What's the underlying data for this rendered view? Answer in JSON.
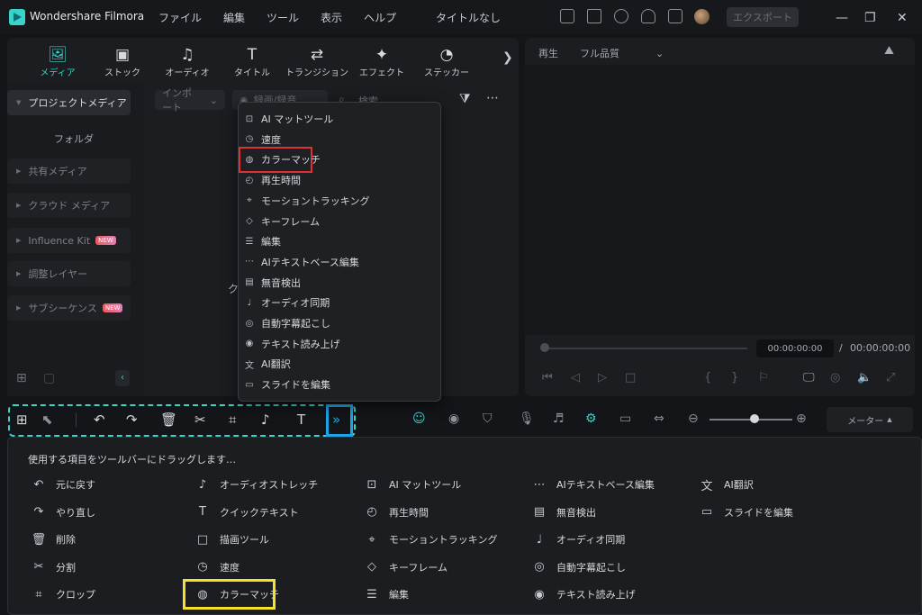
{
  "app": {
    "title": "Wondershare Filmora",
    "doc_title": "タイトルなし",
    "export_label": "エクスポート"
  },
  "menu": [
    "ファイル",
    "編集",
    "ツール",
    "表示",
    "ヘルプ"
  ],
  "media_tabs": [
    {
      "label": "メディア",
      "icon": "media-icon",
      "glyph": "🖼"
    },
    {
      "label": "ストック",
      "icon": "stock-icon",
      "glyph": "▣"
    },
    {
      "label": "オーディオ",
      "icon": "audio-icon",
      "glyph": "♫"
    },
    {
      "label": "タイトル",
      "icon": "title-icon",
      "glyph": "T"
    },
    {
      "label": "トランジション",
      "icon": "transition-icon",
      "glyph": "⇄"
    },
    {
      "label": "エフェクト",
      "icon": "effect-icon",
      "glyph": "✦"
    },
    {
      "label": "ステッカー",
      "icon": "sticker-icon",
      "glyph": "◔"
    }
  ],
  "sidebar": {
    "items": [
      {
        "label": "プロジェクトメディア",
        "active": true,
        "new": false
      },
      {
        "label": "共有メディア",
        "active": false,
        "new": false
      },
      {
        "label": "クラウド メディア",
        "active": false,
        "new": false
      },
      {
        "label": "Influence Kit",
        "active": false,
        "new": true
      },
      {
        "label": "調整レイヤー",
        "active": false,
        "new": false
      },
      {
        "label": "サブシーケンス",
        "active": false,
        "new": true
      }
    ],
    "sub": "フォルダ",
    "new_badge": "NEW"
  },
  "media_toolbar": {
    "import": "インポート",
    "record": "録画/録音",
    "search": "検索",
    "partial": "ク"
  },
  "preview": {
    "play_label": "再生",
    "quality": "フル品質",
    "time_current": "00:00:00:00",
    "time_sep": "/",
    "time_total": "00:00:00:00"
  },
  "dropdown": [
    {
      "label": "AI マットツール",
      "glyph": "⊡"
    },
    {
      "label": "速度",
      "glyph": "◷"
    },
    {
      "label": "カラーマッチ",
      "glyph": "◍"
    },
    {
      "label": "再生時間",
      "glyph": "◴"
    },
    {
      "label": "モーショントラッキング",
      "glyph": "⌖"
    },
    {
      "label": "キーフレーム",
      "glyph": "◇"
    },
    {
      "label": "編集",
      "glyph": "☰"
    },
    {
      "label": "AIテキストベース編集",
      "glyph": "⋯"
    },
    {
      "label": "無音検出",
      "glyph": "▤"
    },
    {
      "label": "オーディオ同期",
      "glyph": "♩"
    },
    {
      "label": "自動字幕起こし",
      "glyph": "◎"
    },
    {
      "label": "テキスト読み上げ",
      "glyph": "◉"
    },
    {
      "label": "AI翻訳",
      "glyph": "文"
    },
    {
      "label": "スライドを編集",
      "glyph": "▭"
    }
  ],
  "meter_label": "メーター",
  "drag_panel": {
    "title": "使用する項目をツールバーにドラッグします…",
    "columns": [
      [
        {
          "label": "元に戻す",
          "glyph": "↶"
        },
        {
          "label": "やり直し",
          "glyph": "↷"
        },
        {
          "label": "削除",
          "glyph": "🗑"
        },
        {
          "label": "分割",
          "glyph": "✂"
        },
        {
          "label": "クロップ",
          "glyph": "⌗"
        }
      ],
      [
        {
          "label": "オーディオストレッチ",
          "glyph": "♪"
        },
        {
          "label": "クイックテキスト",
          "glyph": "T"
        },
        {
          "label": "描画ツール",
          "glyph": "□"
        },
        {
          "label": "速度",
          "glyph": "◷"
        },
        {
          "label": "カラーマッチ",
          "glyph": "◍"
        }
      ],
      [
        {
          "label": "AI マットツール",
          "glyph": "⊡"
        },
        {
          "label": "再生時間",
          "glyph": "◴"
        },
        {
          "label": "モーショントラッキング",
          "glyph": "⌖"
        },
        {
          "label": "キーフレーム",
          "glyph": "◇"
        },
        {
          "label": "編集",
          "glyph": "☰"
        }
      ],
      [
        {
          "label": "AIテキストベース編集",
          "glyph": "⋯"
        },
        {
          "label": "無音検出",
          "glyph": "▤"
        },
        {
          "label": "オーディオ同期",
          "glyph": "♩"
        },
        {
          "label": "自動字幕起こし",
          "glyph": "◎"
        },
        {
          "label": "テキスト読み上げ",
          "glyph": "◉"
        }
      ],
      [
        {
          "label": "AI翻訳",
          "glyph": "文"
        },
        {
          "label": "スライドを編集",
          "glyph": "▭"
        }
      ]
    ]
  },
  "colors": {
    "accent": "#39d3c8",
    "red_highlight": "#e03030",
    "blue_highlight": "#1aa7e8",
    "yellow_highlight": "#f5e12a"
  }
}
